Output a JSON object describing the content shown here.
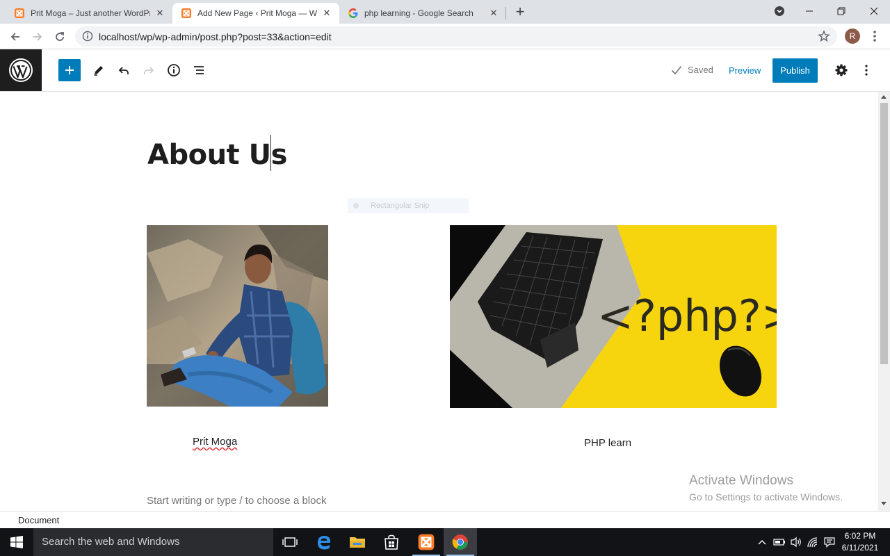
{
  "browser": {
    "tabs": [
      {
        "title": "Prit Moga – Just another WordPr",
        "active": false,
        "favicon": "xampp-icon"
      },
      {
        "title": "Add New Page ‹ Prit Moga — W",
        "active": true,
        "favicon": "xampp-icon"
      },
      {
        "title": "php learning - Google Search",
        "active": false,
        "favicon": "google-icon"
      }
    ],
    "url": "localhost/wp/wp-admin/post.php?post=33&action=edit",
    "profile_initial": "R"
  },
  "editor": {
    "status": "Saved",
    "preview_label": "Preview",
    "publish_label": "Publish",
    "accent_color": "#007cba"
  },
  "content": {
    "title": "About Us",
    "snip_overlay": "Rectangular Snip",
    "php_text": "<?php?>",
    "captions": [
      "Prit Moga",
      "PHP learn"
    ],
    "placeholder": "Start writing or type / to choose a block"
  },
  "footer": {
    "breadcrumb": "Document"
  },
  "watermark": {
    "line1": "Activate Windows",
    "line2": "Go to Settings to activate Windows."
  },
  "taskbar": {
    "search_placeholder": "Search the web and Windows",
    "time": "6:02 PM",
    "date": "6/11/2021"
  }
}
